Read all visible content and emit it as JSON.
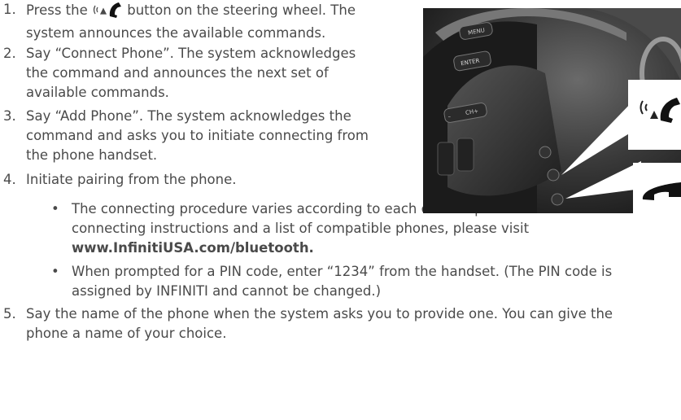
{
  "steps": [
    {
      "number": "1.",
      "lines": [
        "system announces the available commands."
      ],
      "before_icon": "Press the",
      "after_icon": "button on the steering wheel. The",
      "icon": "talk-phone-icon"
    },
    {
      "number": "2.",
      "lines": [
        "Say “Connect Phone”. The system acknowledges",
        "the command and announces the next set of",
        "available commands."
      ]
    },
    {
      "number": "3.",
      "lines": [
        "Say “Add Phone”. The system acknowledges the",
        "command and asks you to initiate connecting from",
        "the phone handset."
      ]
    },
    {
      "number": "4.",
      "lines": [
        "Initiate pairing from the phone."
      ]
    },
    {
      "number": "5.",
      "lines": [
        "Say the name of the phone when the system asks you to provide one. You can give the",
        "phone a name of your choice."
      ]
    }
  ],
  "bullets": [
    {
      "lines": [
        "The connecting procedure varies according to each cellular phone model. For detailed",
        "connecting instructions and a list of compatible phones, please visit"
      ],
      "link": "www.InfinitiUSA.com/bluetooth."
    },
    {
      "lines": [
        "When prompted for a PIN code, enter “1234” from the handset. (The PIN code is",
        "assigned by INFINITI and cannot be changed.)"
      ]
    }
  ],
  "photo": {
    "callout_top_icon": "talk-phone-icon",
    "callout_bottom_icon": "hang-up-icon",
    "button_labels": [
      "MENU",
      "ENTER",
      "–",
      "CH+"
    ]
  },
  "colors": {
    "text": "#4a4a4a",
    "photo_dark": "#2a2a2a",
    "callout_bg": "#ffffff"
  }
}
